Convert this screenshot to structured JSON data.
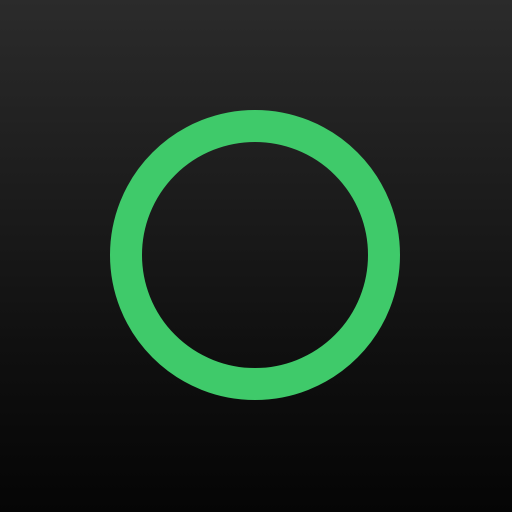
{
  "icon": {
    "name": "circle-ring-icon",
    "ring_color": "#3fca6a",
    "background_top_color": "#2b2b2b",
    "background_bottom_color": "#050505"
  }
}
